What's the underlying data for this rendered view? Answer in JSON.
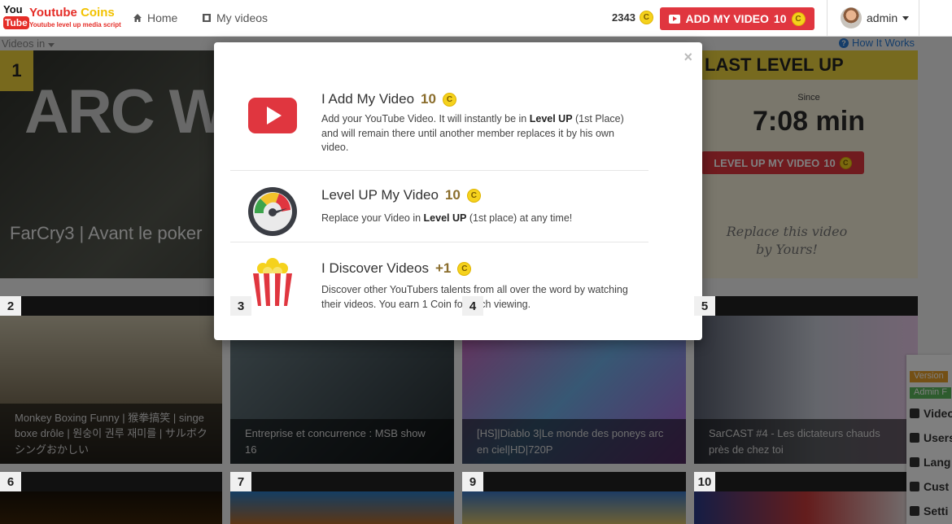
{
  "logo": {
    "you": "You",
    "tube": "Tube",
    "title_main": "Youtube",
    "title_coins": "Coins",
    "tagline": "Youtube level up media script"
  },
  "nav": {
    "home": "Home",
    "my_videos": "My videos"
  },
  "header": {
    "balance": "2343",
    "add_btn_label": "ADD MY VIDEO",
    "add_btn_cost": "10",
    "coin_symbol": "C",
    "user": "admin"
  },
  "subnav": {
    "videos_in": "Videos in",
    "how_it_works": "How It Works"
  },
  "featured": {
    "rank": "1",
    "bigtext": "ARC WITH EAS EPISO",
    "title": "FarCry3 | Avant le poker"
  },
  "last_level": {
    "heading": "LAST LEVEL UP",
    "since_label": "Since",
    "timer": "7:08 min",
    "level_btn": "LEVEL UP MY VIDEO",
    "level_cost": "10",
    "note": "Replace this video by Yours!"
  },
  "thumbnails": [
    {
      "rank": "2",
      "caption": "Monkey Boxing Funny | 猴拳搞笑 | singe boxe drôle | 원숭이 권루 재미를 | サルボクシングおかしい"
    },
    {
      "rank": "3",
      "caption": "Entreprise et concurrence : MSB show 16"
    },
    {
      "rank": "4",
      "caption": "[HS]|Diablo 3|Le monde des poneys arc en ciel|HD|720P"
    },
    {
      "rank": "5",
      "caption": "SarCAST #4 - Les dictateurs chauds près de chez toi"
    },
    {
      "rank": "6",
      "caption": ""
    },
    {
      "rank": "7",
      "caption": ""
    },
    {
      "rank": "9",
      "caption": ""
    },
    {
      "rank": "10",
      "caption": ""
    }
  ],
  "admin_panel": {
    "version": "Version",
    "admin_f": "Admin F",
    "items": [
      "Video",
      "Users",
      "Lang",
      "Cust",
      "Setti"
    ]
  },
  "modal": {
    "close": "×",
    "items": [
      {
        "title": "I Add My Video",
        "amount": "10",
        "desc_parts": [
          "Add your YouTube Video. It will instantly be in ",
          "Level UP",
          " (1st Place) and will remain there until another member replaces it by his own video."
        ]
      },
      {
        "title": "Level UP My Video",
        "amount": "10",
        "desc_parts": [
          "Replace your Video in ",
          "Level UP",
          " (1st place) at any time!"
        ]
      },
      {
        "title": "I Discover Videos",
        "amount": "+1",
        "desc_parts": [
          "Discover other YouTubers talents from all over the word by watching their videos. You earn 1 Coin for each viewing."
        ]
      }
    ]
  },
  "colors": {
    "accent_red": "#e0363f",
    "coin_gold": "#f5d21d",
    "level_yellow": "#efd53e",
    "link_blue": "#2a7bd4"
  }
}
